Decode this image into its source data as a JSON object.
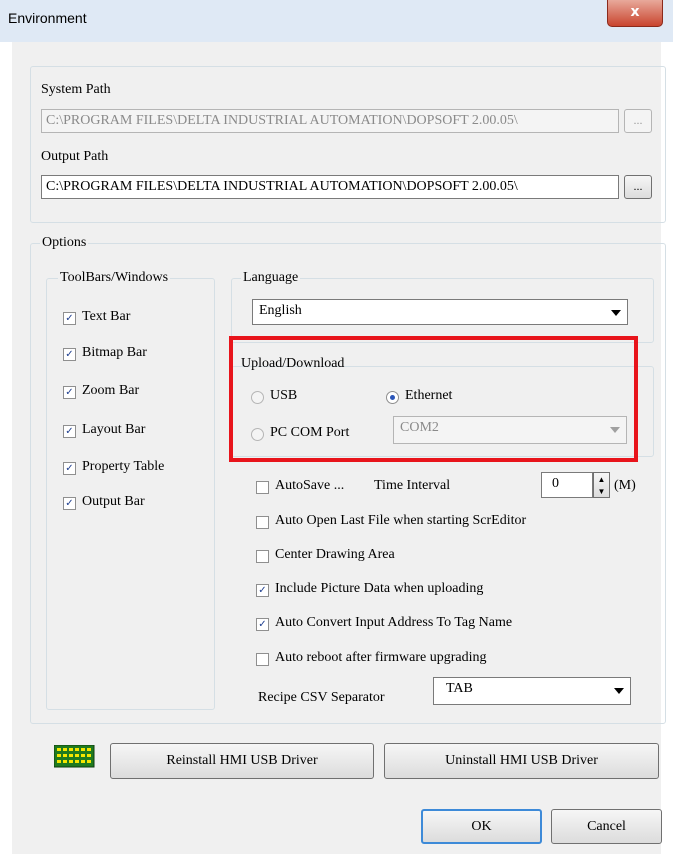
{
  "window": {
    "title": "Environment",
    "close_glyph": "x"
  },
  "system_path": {
    "label": "System Path",
    "value": "C:\\PROGRAM FILES\\DELTA INDUSTRIAL AUTOMATION\\DOPSOFT 2.00.05\\",
    "browse": "..."
  },
  "output_path": {
    "label": "Output Path",
    "value": "C:\\PROGRAM FILES\\DELTA INDUSTRIAL AUTOMATION\\DOPSOFT 2.00.05\\",
    "browse": "..."
  },
  "options": {
    "label": "Options",
    "toolbars": {
      "label": "ToolBars/Windows",
      "items": [
        {
          "label": "Text Bar",
          "checked": true
        },
        {
          "label": "Bitmap Bar",
          "checked": true
        },
        {
          "label": "Zoom Bar",
          "checked": true
        },
        {
          "label": "Layout Bar",
          "checked": true
        },
        {
          "label": "Property Table",
          "checked": true
        },
        {
          "label": "Output Bar",
          "checked": true
        }
      ]
    },
    "language": {
      "label": "Language",
      "value": "English"
    },
    "upload": {
      "label": "Upload/Download",
      "usb": "USB",
      "ethernet": "Ethernet",
      "com_port": "PC COM Port",
      "com_value": "COM2",
      "selected": "Ethernet",
      "highlight_color": "#e8141b"
    },
    "autosave": {
      "label": "AutoSave ...",
      "interval_label": "Time Interval",
      "value": "0",
      "unit": "(M)",
      "checked": false
    },
    "checks": [
      {
        "label": "Auto Open Last File when starting ScrEditor",
        "checked": false
      },
      {
        "label": "Center Drawing Area",
        "checked": false
      },
      {
        "label": "Include Picture Data when uploading",
        "checked": true
      },
      {
        "label": "Auto Convert Input Address To Tag Name",
        "checked": true
      },
      {
        "label": "Auto reboot after firmware upgrading",
        "checked": false
      }
    ],
    "csv": {
      "label": "Recipe CSV Separator",
      "value": "TAB"
    }
  },
  "buttons": {
    "reinstall": "Reinstall HMI USB Driver",
    "uninstall": "Uninstall HMI USB Driver",
    "ok": "OK",
    "cancel": "Cancel"
  },
  "check_glyph": "✓",
  "icons": {
    "usb_driver": "usb-driver-icon"
  }
}
